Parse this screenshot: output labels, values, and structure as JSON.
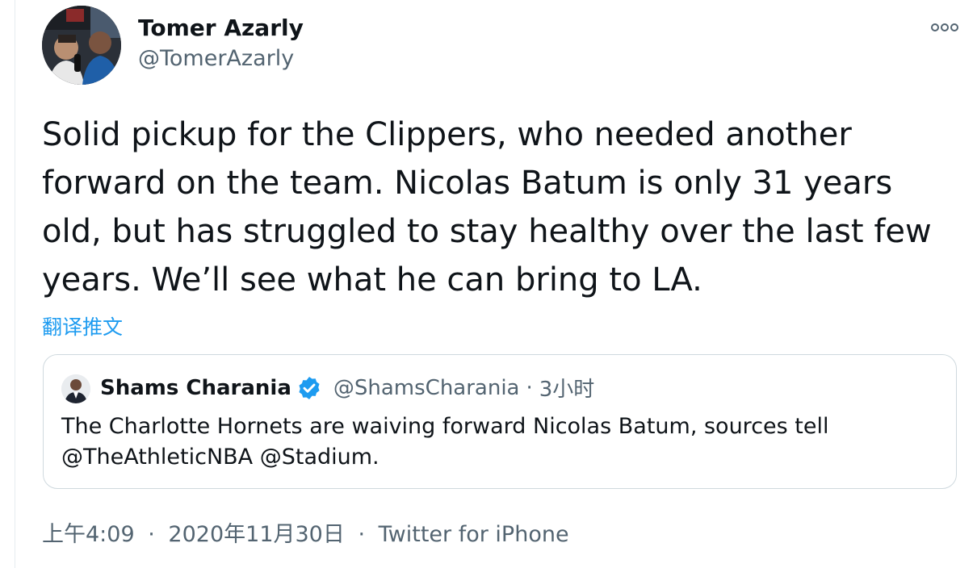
{
  "author": {
    "display_name": "Tomer Azarly",
    "handle": "@TomerAzarly"
  },
  "tweet": {
    "text": "Solid pickup for the Clippers, who needed another forward on the team. Nicolas Batum is only 31 years old, but has struggled to stay healthy over the last few years. We’ll see what he can bring to LA.",
    "translate_label": "翻译推文"
  },
  "quoted_tweet": {
    "display_name": "Shams Charania",
    "handle": "@ShamsCharania",
    "separator": "·",
    "time": "3小时",
    "text": "The Charlotte Hornets are waiving forward Nicolas Batum, sources tell @TheAthleticNBA @Stadium."
  },
  "meta": {
    "time": "上午4:09",
    "separator": "·",
    "date": "2020年11月30日",
    "source": "Twitter for iPhone"
  },
  "colors": {
    "link_blue": "#1d9bf0",
    "secondary_text": "#536471",
    "border": "#cfd9de",
    "verified_blue": "#1d9bf0"
  },
  "icons": {
    "more": "more-horizontal-icon",
    "verified": "verified-badge-icon"
  }
}
